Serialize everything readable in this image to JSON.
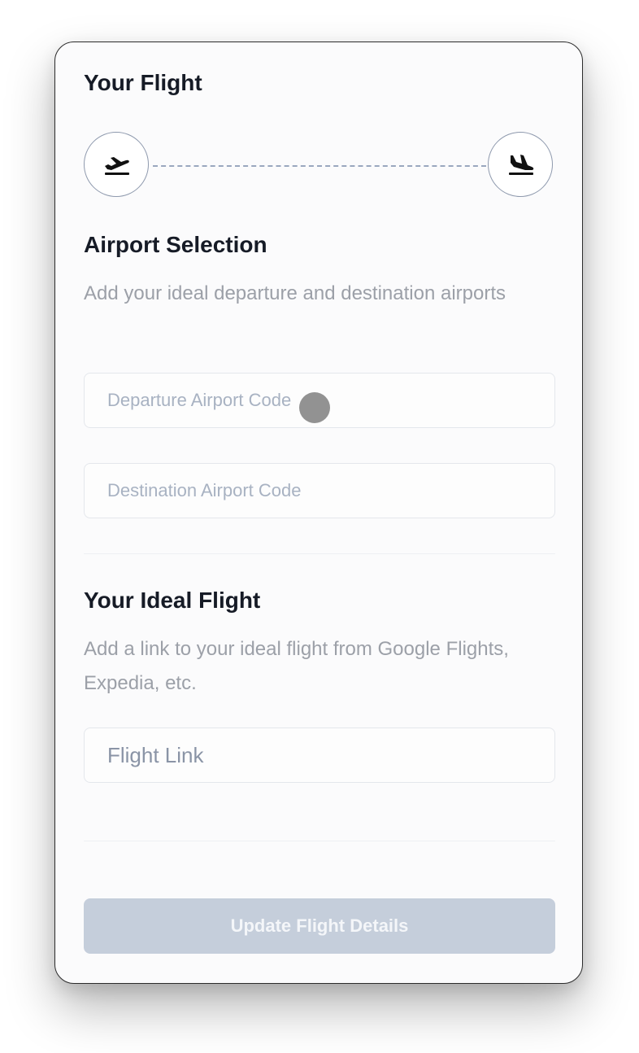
{
  "header": {
    "title": "Your Flight"
  },
  "route": {
    "departure_icon": "airplane-takeoff-icon",
    "arrival_icon": "airplane-landing-icon"
  },
  "airport_section": {
    "title": "Airport Selection",
    "description": "Add your ideal departure and destination airports",
    "departure_field": {
      "placeholder": "Departure Airport Code",
      "value": ""
    },
    "destination_field": {
      "placeholder": "Destination Airport Code",
      "value": ""
    }
  },
  "ideal_flight_section": {
    "title": "Your Ideal Flight",
    "description": "Add a link to your ideal flight from Google Flights, Expedia, etc.",
    "link_field": {
      "placeholder": "Flight Link",
      "value": ""
    }
  },
  "actions": {
    "submit_label": "Update Flight Details"
  },
  "colors": {
    "heading": "#161b26",
    "subtext": "#9ca0a8",
    "button_disabled_bg": "#c5cedb",
    "route_line": "#9aa7bf"
  }
}
